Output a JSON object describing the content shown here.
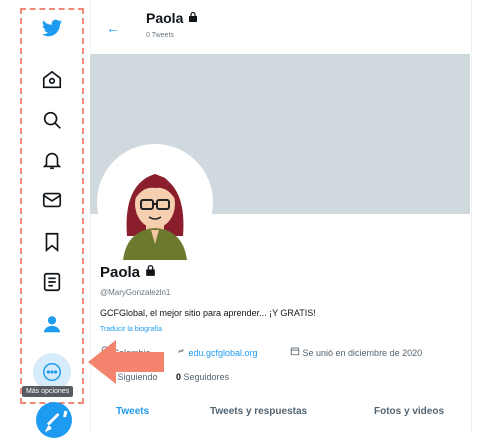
{
  "sidebar": {
    "items": [
      {
        "name": "twitter-logo-icon"
      },
      {
        "name": "home-icon"
      },
      {
        "name": "explore-icon"
      },
      {
        "name": "notifications-icon"
      },
      {
        "name": "messages-icon"
      },
      {
        "name": "bookmarks-icon"
      },
      {
        "name": "lists-icon"
      },
      {
        "name": "profile-icon"
      },
      {
        "name": "more-options-icon"
      }
    ],
    "tooltip": "Más opciones"
  },
  "header": {
    "back_arrow": "←",
    "name": "Paola",
    "tweets_count": "0 Tweets"
  },
  "profile": {
    "name": "Paola",
    "handle": "@MaryGonzalezln1",
    "bio": "GCFGlobal, el mejor sitio para aprender... ¡Y GRATIS!",
    "translate": "Traducir la biografía",
    "location": "Colombia",
    "website": "edu.gcfglobal.org",
    "joined": "Se unió en diciembre de 2020",
    "following_count": "0",
    "following_label": "Siguiendo",
    "followers_count": "0",
    "followers_label": "Seguidores"
  },
  "tabs": [
    {
      "label": "Tweets"
    },
    {
      "label": "Tweets y respuestas"
    },
    {
      "label": "Fotos y videos"
    }
  ],
  "colors": {
    "accent": "#1d9bf0",
    "highlight": "#f08a7a"
  }
}
